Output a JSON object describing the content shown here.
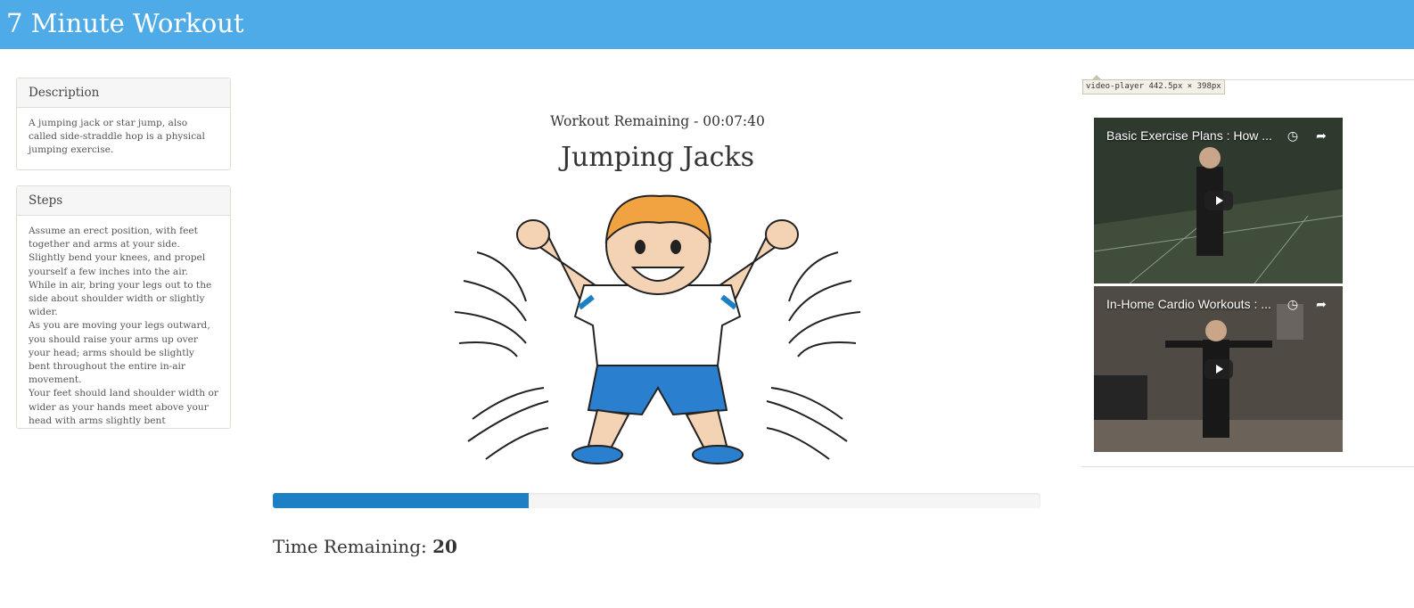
{
  "header": {
    "title": "7 Minute Workout"
  },
  "description": {
    "heading": "Description",
    "text": "A jumping jack or star jump, also called side-straddle hop is a physical jumping exercise."
  },
  "steps": {
    "heading": "Steps",
    "lines": [
      "Assume an erect position, with feet together and arms at your side.",
      "Slightly bend your knees, and propel yourself a few inches into the air.",
      "While in air, bring your legs out to the side about shoulder width or slightly wider.",
      "As you are moving your legs outward, you should raise your arms up over your head; arms should be slightly bent throughout the entire in-air movement.",
      "Your feet should land shoulder width or wider as your hands meet above your head with arms slightly bent"
    ]
  },
  "workout": {
    "remaining_label": "Workout Remaining - 00:07:40",
    "exercise_name": "Jumping Jacks",
    "image_icon": "jumping-jacks-illustration",
    "progress_fraction": 0.333,
    "progress_color": "#1E80C4",
    "time_remaining_label": "Time Remaining:",
    "time_remaining_value": "20"
  },
  "videos": {
    "dimension_tooltip": "video-player 442.5px × 398px",
    "items": [
      {
        "title": "Basic Exercise Plans : How ..."
      },
      {
        "title": "In-Home Cardio Workouts : ..."
      }
    ]
  },
  "colors": {
    "navbar": "#4FABE8",
    "panel_border": "#e3dcd2"
  }
}
